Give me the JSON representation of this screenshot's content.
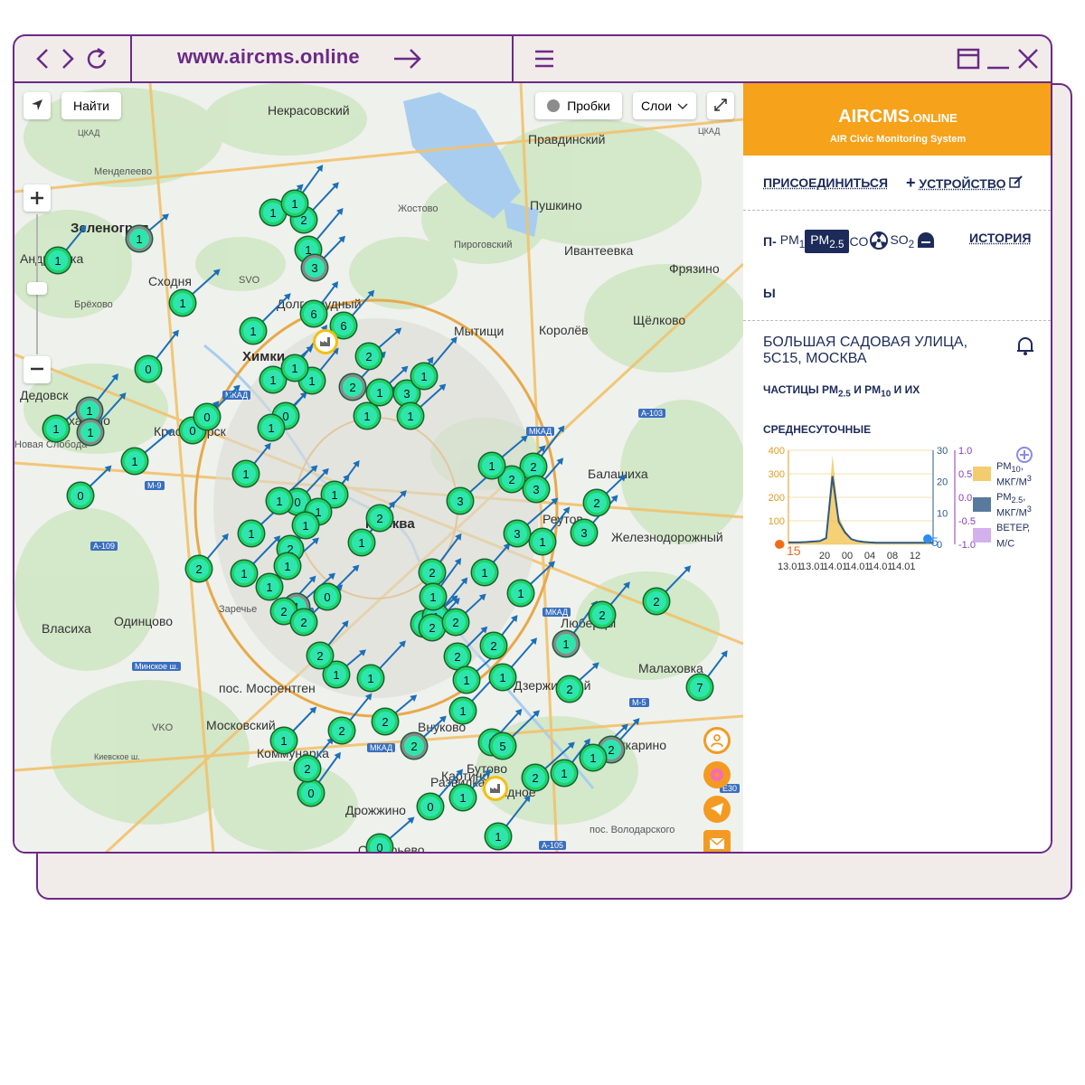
{
  "browser": {
    "url": "www.aircms.online"
  },
  "map": {
    "find_button": "Найти",
    "traffic_button": "Пробки",
    "layers_button": "Слои",
    "labels": [
      {
        "text": "Некрасовский",
        "cls": ""
      },
      {
        "text": "Правдинский",
        "cls": ""
      },
      {
        "text": "Менделеево",
        "cls": "small"
      },
      {
        "text": "Жостово",
        "cls": "small"
      },
      {
        "text": "Пушкино",
        "cls": ""
      },
      {
        "text": "Зеленоград",
        "cls": "big"
      },
      {
        "text": "Пироговский",
        "cls": "small"
      },
      {
        "text": "Ивантеевка",
        "cls": ""
      },
      {
        "text": "Андреевка",
        "cls": ""
      },
      {
        "text": "Сходня",
        "cls": ""
      },
      {
        "text": "SVO",
        "cls": "small"
      },
      {
        "text": "Фрязино",
        "cls": ""
      },
      {
        "text": "Брёхово",
        "cls": "small"
      },
      {
        "text": "Долгопрудный",
        "cls": ""
      },
      {
        "text": "Мытищи",
        "cls": ""
      },
      {
        "text": "Королёв",
        "cls": ""
      },
      {
        "text": "Щёлково",
        "cls": ""
      },
      {
        "text": "Химки",
        "cls": "big"
      },
      {
        "text": "Дедовск",
        "cls": ""
      },
      {
        "text": "Нахабино",
        "cls": ""
      },
      {
        "text": "Красногорск",
        "cls": ""
      },
      {
        "text": "Новая Слобода",
        "cls": "small"
      },
      {
        "text": "Балашиха",
        "cls": ""
      },
      {
        "text": "Москва",
        "cls": "big"
      },
      {
        "text": "Реутов",
        "cls": ""
      },
      {
        "text": "Железнодорожный",
        "cls": ""
      },
      {
        "text": "Власиха",
        "cls": ""
      },
      {
        "text": "Одинцово",
        "cls": ""
      },
      {
        "text": "Заречье",
        "cls": "small"
      },
      {
        "text": "Люберцы",
        "cls": ""
      },
      {
        "text": "Малаховка",
        "cls": ""
      },
      {
        "text": "пос. Мосрентген",
        "cls": ""
      },
      {
        "text": "Дзержинский",
        "cls": ""
      },
      {
        "text": "Московский",
        "cls": ""
      },
      {
        "text": "VKO",
        "cls": "small"
      },
      {
        "text": "Лыткарино",
        "cls": ""
      },
      {
        "text": "Дрожжино",
        "cls": ""
      },
      {
        "text": "пос. Володарского",
        "cls": "small"
      },
      {
        "text": "Видное",
        "cls": ""
      },
      {
        "text": "Остафьево",
        "cls": ""
      },
      {
        "text": "Внуково",
        "cls": ""
      },
      {
        "text": "Коммунарка",
        "cls": ""
      },
      {
        "text": "Картино",
        "cls": ""
      },
      {
        "text": "Развилка",
        "cls": ""
      },
      {
        "text": "Бутово",
        "cls": ""
      }
    ],
    "road_labels": [
      "ЦКАД",
      "ЦКАД",
      "МКАД",
      "МКАД",
      "МКАД",
      "МКАД",
      "МКАД",
      "М-9",
      "А-109",
      "Минское ш.",
      "Киевское ш.",
      "А-103",
      "М-5",
      "А-105",
      "E30"
    ],
    "markers": [
      {
        "n": "1"
      },
      {
        "n": "1"
      },
      {
        "n": "2"
      },
      {
        "n": "1"
      },
      {
        "n": "1"
      },
      {
        "n": "1"
      },
      {
        "n": "3"
      },
      {
        "n": "1"
      },
      {
        "n": "6"
      },
      {
        "n": "6"
      },
      {
        "n": "1"
      },
      {
        "n": "2"
      },
      {
        "n": "0"
      },
      {
        "n": "0"
      },
      {
        "n": "0"
      },
      {
        "n": "1"
      },
      {
        "n": "1"
      },
      {
        "n": "2"
      },
      {
        "n": "1"
      },
      {
        "n": "3"
      },
      {
        "n": "1"
      },
      {
        "n": "1"
      },
      {
        "n": "1"
      },
      {
        "n": "1"
      },
      {
        "n": "0"
      },
      {
        "n": "1"
      },
      {
        "n": "1"
      },
      {
        "n": "1"
      },
      {
        "n": "1"
      },
      {
        "n": "0"
      },
      {
        "n": "1"
      },
      {
        "n": "1"
      },
      {
        "n": "0"
      },
      {
        "n": "1"
      },
      {
        "n": "1"
      },
      {
        "n": "1"
      },
      {
        "n": "2"
      },
      {
        "n": "3"
      },
      {
        "n": "2"
      },
      {
        "n": "3"
      },
      {
        "n": "2"
      },
      {
        "n": "3"
      },
      {
        "n": "1"
      },
      {
        "n": "3"
      },
      {
        "n": "2"
      },
      {
        "n": "1"
      },
      {
        "n": "1"
      },
      {
        "n": "2"
      },
      {
        "n": "1"
      },
      {
        "n": "1"
      },
      {
        "n": "2"
      },
      {
        "n": "1"
      },
      {
        "n": "1"
      },
      {
        "n": "2"
      },
      {
        "n": "1"
      },
      {
        "n": "0"
      },
      {
        "n": "1"
      },
      {
        "n": "1"
      },
      {
        "n": "2"
      },
      {
        "n": "2"
      },
      {
        "n": "1"
      },
      {
        "n": "1"
      },
      {
        "n": "2"
      },
      {
        "n": "1"
      },
      {
        "n": "1"
      },
      {
        "n": "2"
      },
      {
        "n": "2"
      },
      {
        "n": "2"
      },
      {
        "n": "7"
      },
      {
        "n": "1"
      },
      {
        "n": "2"
      },
      {
        "n": "1"
      },
      {
        "n": "2"
      },
      {
        "n": "2"
      },
      {
        "n": "5"
      },
      {
        "n": "2"
      },
      {
        "n": "2"
      },
      {
        "n": "1"
      },
      {
        "n": "2"
      },
      {
        "n": "0"
      },
      {
        "n": "2"
      },
      {
        "n": "1"
      },
      {
        "n": "2"
      },
      {
        "n": "1"
      },
      {
        "n": "0"
      },
      {
        "n": "1"
      },
      {
        "n": "0"
      },
      {
        "n": "1"
      },
      {
        "n": "2"
      },
      {
        "n": "1"
      },
      {
        "n": "1"
      },
      {
        "n": "2"
      },
      {
        "n": "1"
      },
      {
        "n": "2"
      },
      {
        "n": "1"
      }
    ]
  },
  "panel": {
    "brand": "AIRCMS",
    "brand_suffix": ".ONLINE",
    "subtitle": "AIR Civic Monitoring System",
    "join_link": "ПРИСОЕДИНИТЬСЯ",
    "device_link": "УСТРОЙСТВО",
    "device_plus": "+",
    "tabs_prefix": "П-",
    "tab_pm1": "PM",
    "tab_pm1_sub": "1",
    "tab_pm25": "PM",
    "tab_pm25_sub": "2.5",
    "tab_co": "CO",
    "tab_so2": "SO",
    "tab_so2_sub": "2",
    "history_link": "ИСТОРИЯ",
    "wrap_letter": "Ы",
    "address_line1": "БОЛЬШАЯ САДОВАЯ УЛИЦА,",
    "address_line2": "5С15, МОСКВА",
    "particles_text": "ЧАСТИЦЫ PM",
    "particles_sub1": "2.5",
    "particles_mid": " И PM",
    "particles_sub2": "10",
    "particles_end": " И ИХ",
    "daily_label": "СРЕДНЕСУТОЧНЫЕ",
    "chart_left_marker_value": "15",
    "chart_right_marker_value": "5",
    "legend": [
      {
        "line1": "PM",
        "sub": "10",
        "tail": ",",
        "line2": "МКГ/М",
        "sup": "3",
        "color": "#f1c04a"
      },
      {
        "line1": "PM",
        "sub": "2.5",
        "tail": ",",
        "line2": "МКГ/М",
        "sup": "3",
        "color": "#2e5a86"
      },
      {
        "line1": "ВЕТЕР,",
        "sub": "",
        "tail": "",
        "line2": "М/С",
        "sup": "",
        "color": "#c89ee8"
      }
    ]
  },
  "chart_data": {
    "type": "line",
    "x_tick_labels": [
      "13.01",
      "13.01",
      "14.01",
      "14.01",
      "14.01",
      "14.01"
    ],
    "x_tick_top": [
      "20",
      "00",
      "04",
      "08",
      "12"
    ],
    "y_left_ticks": [
      "400",
      "300",
      "200",
      "100",
      "0"
    ],
    "y_mid_ticks": [
      "30",
      "20",
      "10",
      "0"
    ],
    "y_right_ticks": [
      "1.0",
      "0.5",
      "0.0",
      "-0.5",
      "-1.0"
    ],
    "ylim_left": [
      0,
      400
    ],
    "ylim_mid": [
      0,
      30
    ],
    "ylim_right": [
      -1.0,
      1.0
    ],
    "series": [
      {
        "name": "PM10, мкг/м3",
        "color": "#f1c04a",
        "values": [
          5,
          5,
          6,
          8,
          10,
          12,
          30,
          380,
          120,
          60,
          25,
          15,
          8,
          5,
          5,
          5,
          5,
          5,
          5,
          5,
          5,
          5,
          5,
          5
        ]
      },
      {
        "name": "PM2.5, мкг/м3",
        "color": "#2e5a86",
        "values": [
          8,
          8,
          9,
          10,
          12,
          14,
          26,
          290,
          95,
          50,
          22,
          14,
          10,
          8,
          7,
          7,
          7,
          7,
          7,
          7,
          7,
          7,
          7,
          7
        ]
      }
    ]
  }
}
